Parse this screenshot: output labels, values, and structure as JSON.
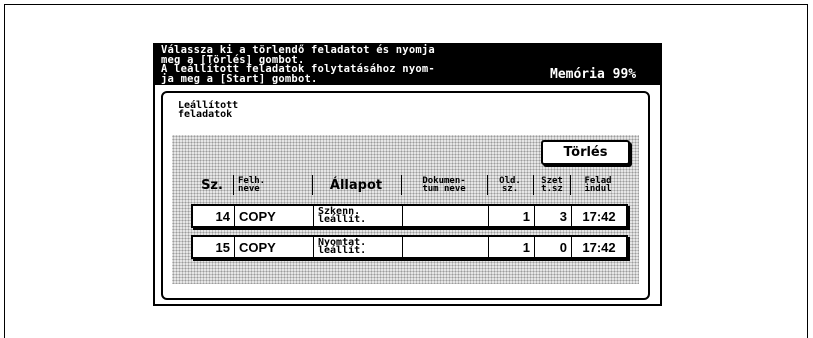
{
  "header": {
    "message_lines": [
      "Válassza ki a törlendő feladatot és nyomja",
      "meg a [Törlés] gombot.",
      "A leállított feladatok folytatásához nyom-",
      "ja meg a [Start] gombot."
    ],
    "memory_label": "Memória 99%"
  },
  "panel": {
    "title_lines": [
      "Leállított",
      "feladatok"
    ],
    "delete_button": "Törlés"
  },
  "table": {
    "columns": [
      {
        "lines": [
          "Sz."
        ]
      },
      {
        "lines": [
          "Felh.",
          "neve"
        ]
      },
      {
        "lines": [
          "Állapot"
        ]
      },
      {
        "lines": [
          "Dokumen-",
          "tum neve"
        ]
      },
      {
        "lines": [
          "Old.",
          "sz."
        ]
      },
      {
        "lines": [
          "Szet",
          "t.sz"
        ]
      },
      {
        "lines": [
          "Felad",
          "indul"
        ]
      }
    ],
    "rows": [
      {
        "num": "14",
        "user": "COPY",
        "status_lines": [
          "Szkenn.",
          "leállít."
        ],
        "doc": "",
        "pages": "1",
        "sets": "3",
        "start": "17:42"
      },
      {
        "num": "15",
        "user": "COPY",
        "status_lines": [
          "Nyomtat.",
          "leállít."
        ],
        "doc": "",
        "pages": "1",
        "sets": "0",
        "start": "17:42"
      }
    ]
  }
}
